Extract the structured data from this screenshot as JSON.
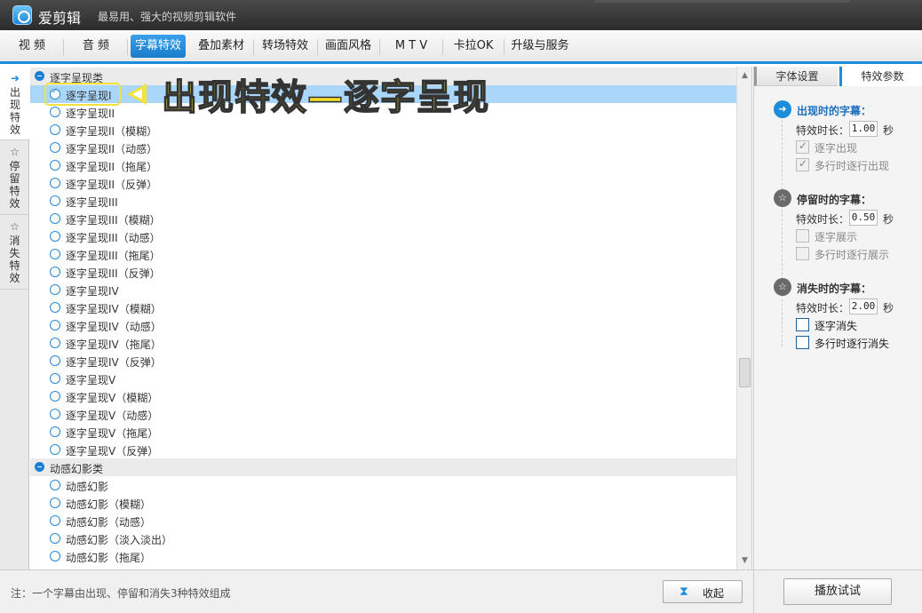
{
  "app": {
    "name": "爱剪辑",
    "slogan": "最易用、强大的视频剪辑软件"
  },
  "menu": {
    "tabs": [
      {
        "label": "视  频"
      },
      {
        "label": "音  频"
      },
      {
        "label": "字幕特效",
        "active": true
      },
      {
        "label": "叠加素材"
      },
      {
        "label": "转场特效"
      },
      {
        "label": "画面风格"
      },
      {
        "label": "M T V"
      },
      {
        "label": "卡拉OK"
      },
      {
        "label": "升级与服务"
      }
    ]
  },
  "side_tabs": [
    {
      "label": "出现特效",
      "icon": "appear-icon",
      "active": true
    },
    {
      "label": "停留特效",
      "icon": "star-icon"
    },
    {
      "label": "消失特效",
      "icon": "disappear-icon"
    }
  ],
  "effect_list": {
    "categories": [
      {
        "label": "逐字呈现类",
        "items": [
          {
            "label": "逐字呈现I",
            "selected": true
          },
          {
            "label": "逐字呈现II"
          },
          {
            "label": "逐字呈现II（模糊）"
          },
          {
            "label": "逐字呈现II（动感）"
          },
          {
            "label": "逐字呈现II（拖尾）"
          },
          {
            "label": "逐字呈现II（反弹）"
          },
          {
            "label": "逐字呈现III"
          },
          {
            "label": "逐字呈现III（模糊）"
          },
          {
            "label": "逐字呈现III（动感）"
          },
          {
            "label": "逐字呈现III（拖尾）"
          },
          {
            "label": "逐字呈现III（反弹）"
          },
          {
            "label": "逐字呈现IV"
          },
          {
            "label": "逐字呈现IV（模糊）"
          },
          {
            "label": "逐字呈现IV（动感）"
          },
          {
            "label": "逐字呈现IV（拖尾）"
          },
          {
            "label": "逐字呈现IV（反弹）"
          },
          {
            "label": "逐字呈现V"
          },
          {
            "label": "逐字呈现V（模糊）"
          },
          {
            "label": "逐字呈现V（动感）"
          },
          {
            "label": "逐字呈现V（拖尾）"
          },
          {
            "label": "逐字呈现V（反弹）"
          }
        ]
      },
      {
        "label": "动感幻影类",
        "items": [
          {
            "label": "动感幻影"
          },
          {
            "label": "动感幻影（模糊）"
          },
          {
            "label": "动感幻影（动感）"
          },
          {
            "label": "动感幻影（淡入淡出）"
          },
          {
            "label": "动感幻影（拖尾）"
          }
        ]
      }
    ]
  },
  "annotation": {
    "text": "出现特效—逐字呈现",
    "color": "#f7e12b"
  },
  "right_panel": {
    "tabs": [
      {
        "label": "字体设置"
      },
      {
        "label": "特效参数",
        "active": true
      }
    ],
    "sections": [
      {
        "title": "出现时的字幕：",
        "icon": "appear-icon",
        "active": true,
        "duration_label": "特效时长：",
        "duration_value": "1.00",
        "unit": "秒",
        "options": [
          {
            "label": "逐字出现",
            "checked": true,
            "disabled": true
          },
          {
            "label": "多行时逐行出现",
            "checked": true,
            "disabled": true
          }
        ]
      },
      {
        "title": "停留时的字幕：",
        "icon": "star-icon",
        "duration_label": "特效时长：",
        "duration_value": "0.50",
        "unit": "秒",
        "options": [
          {
            "label": "逐字展示",
            "checked": false,
            "disabled": true
          },
          {
            "label": "多行时逐行展示",
            "checked": false,
            "disabled": true
          }
        ]
      },
      {
        "title": "消失时的字幕：",
        "icon": "disappear-icon",
        "duration_label": "特效时长：",
        "duration_value": "2.00",
        "unit": "秒",
        "options": [
          {
            "label": "逐字消失",
            "checked": false,
            "disabled": false
          },
          {
            "label": "多行时逐行消失",
            "checked": false,
            "disabled": false
          }
        ]
      }
    ],
    "preview_button": "播放试试"
  },
  "bottom": {
    "note": "注：一个字幕由出现、停留和消失3种特效组成",
    "collapse_button": "收起"
  },
  "colors": {
    "accent": "#1c8cdc",
    "selected_row": "#a9d6f9",
    "category_bg": "#ebebeb"
  }
}
